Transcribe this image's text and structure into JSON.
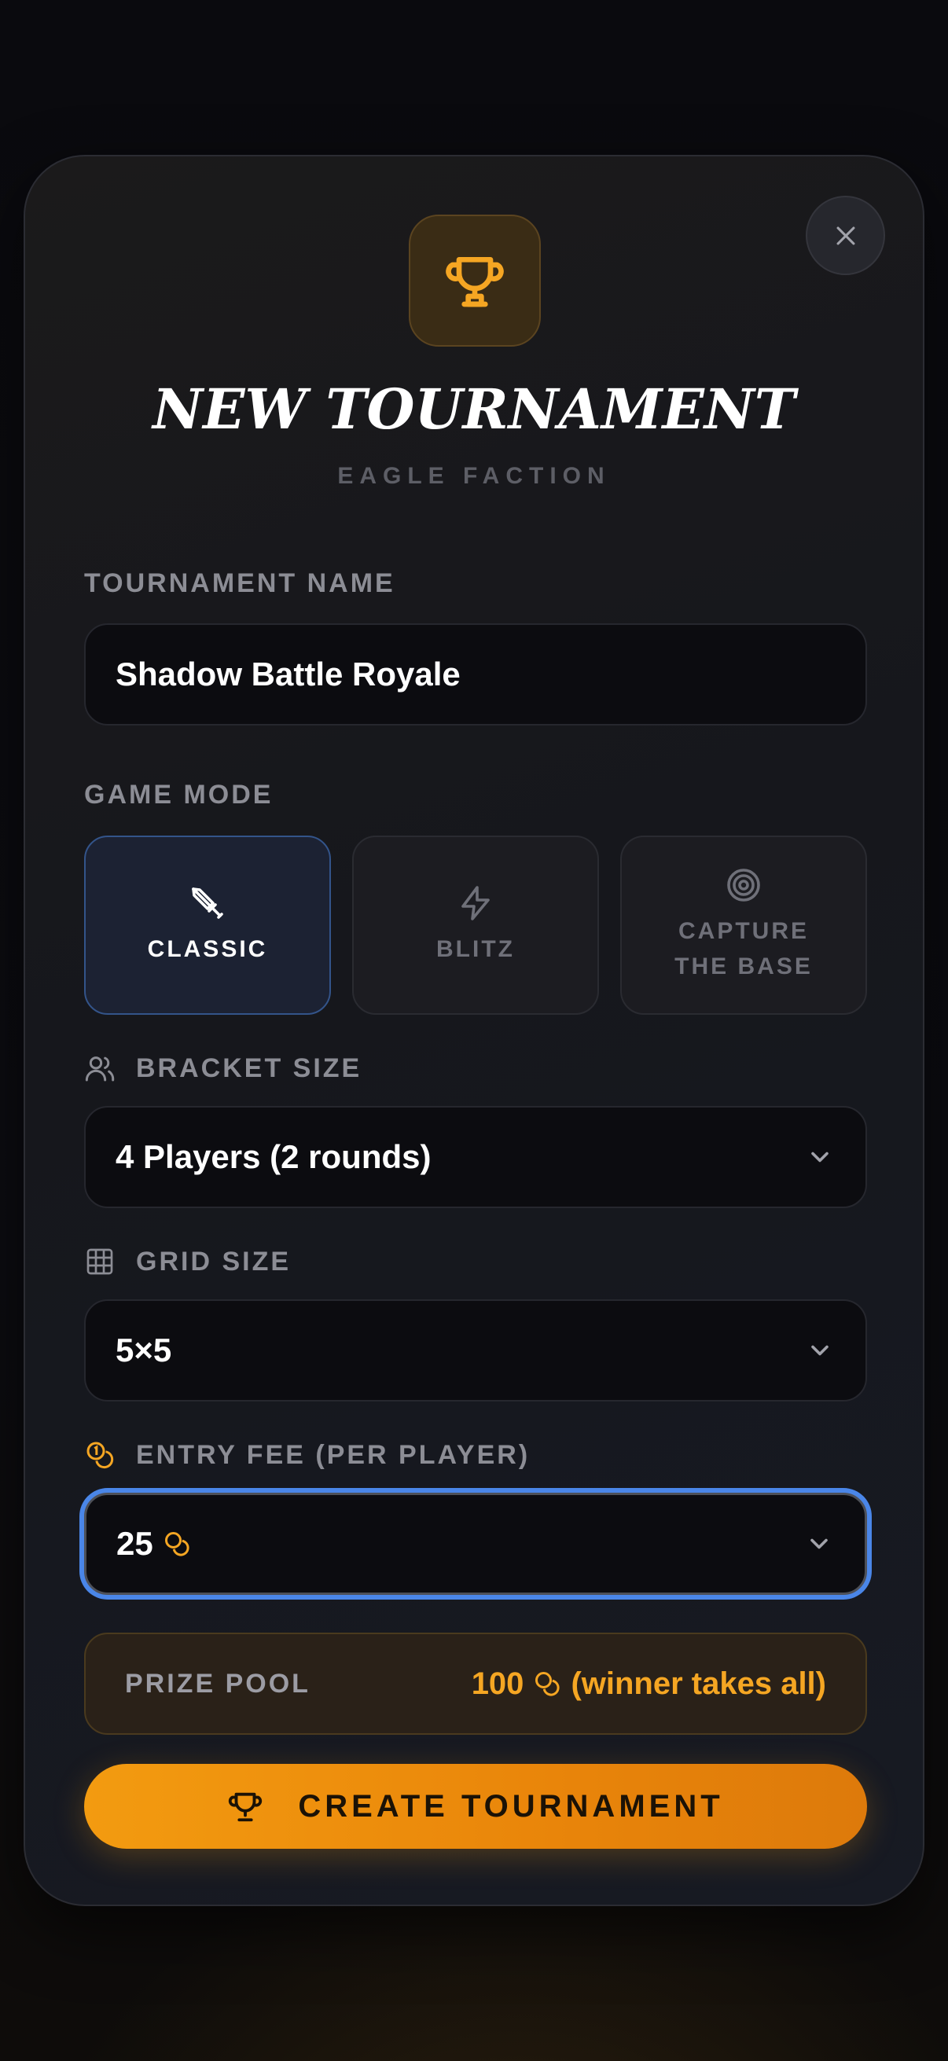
{
  "header": {
    "title": "NEW TOURNAMENT",
    "subtitle": "EAGLE FACTION"
  },
  "tournament_name": {
    "label": "TOURNAMENT NAME",
    "value": "Shadow Battle Royale"
  },
  "game_mode": {
    "label": "GAME MODE",
    "options": [
      {
        "label": "CLASSIC",
        "icon": "sword-icon",
        "selected": true
      },
      {
        "label": "BLITZ",
        "icon": "lightning-icon",
        "selected": false
      },
      {
        "label_line1": "CAPTURE",
        "label_line2": "THE BASE",
        "icon": "target-icon",
        "selected": false
      }
    ]
  },
  "bracket_size": {
    "label": "BRACKET SIZE",
    "icon": "users-icon",
    "value": "4 Players (2 rounds)"
  },
  "grid_size": {
    "label": "GRID SIZE",
    "icon": "grid-icon",
    "value": "5×5"
  },
  "entry_fee": {
    "label": "ENTRY FEE (PER PLAYER)",
    "icon": "coins-icon",
    "value": "25"
  },
  "prize_pool": {
    "label": "PRIZE POOL",
    "amount": "100",
    "note": "(winner takes all)"
  },
  "actions": {
    "create_label": "CREATE TOURNAMENT"
  },
  "colors": {
    "accent_gold": "#f5a623",
    "focus_blue": "#4a86e8",
    "selected_blue": "#33548a"
  }
}
